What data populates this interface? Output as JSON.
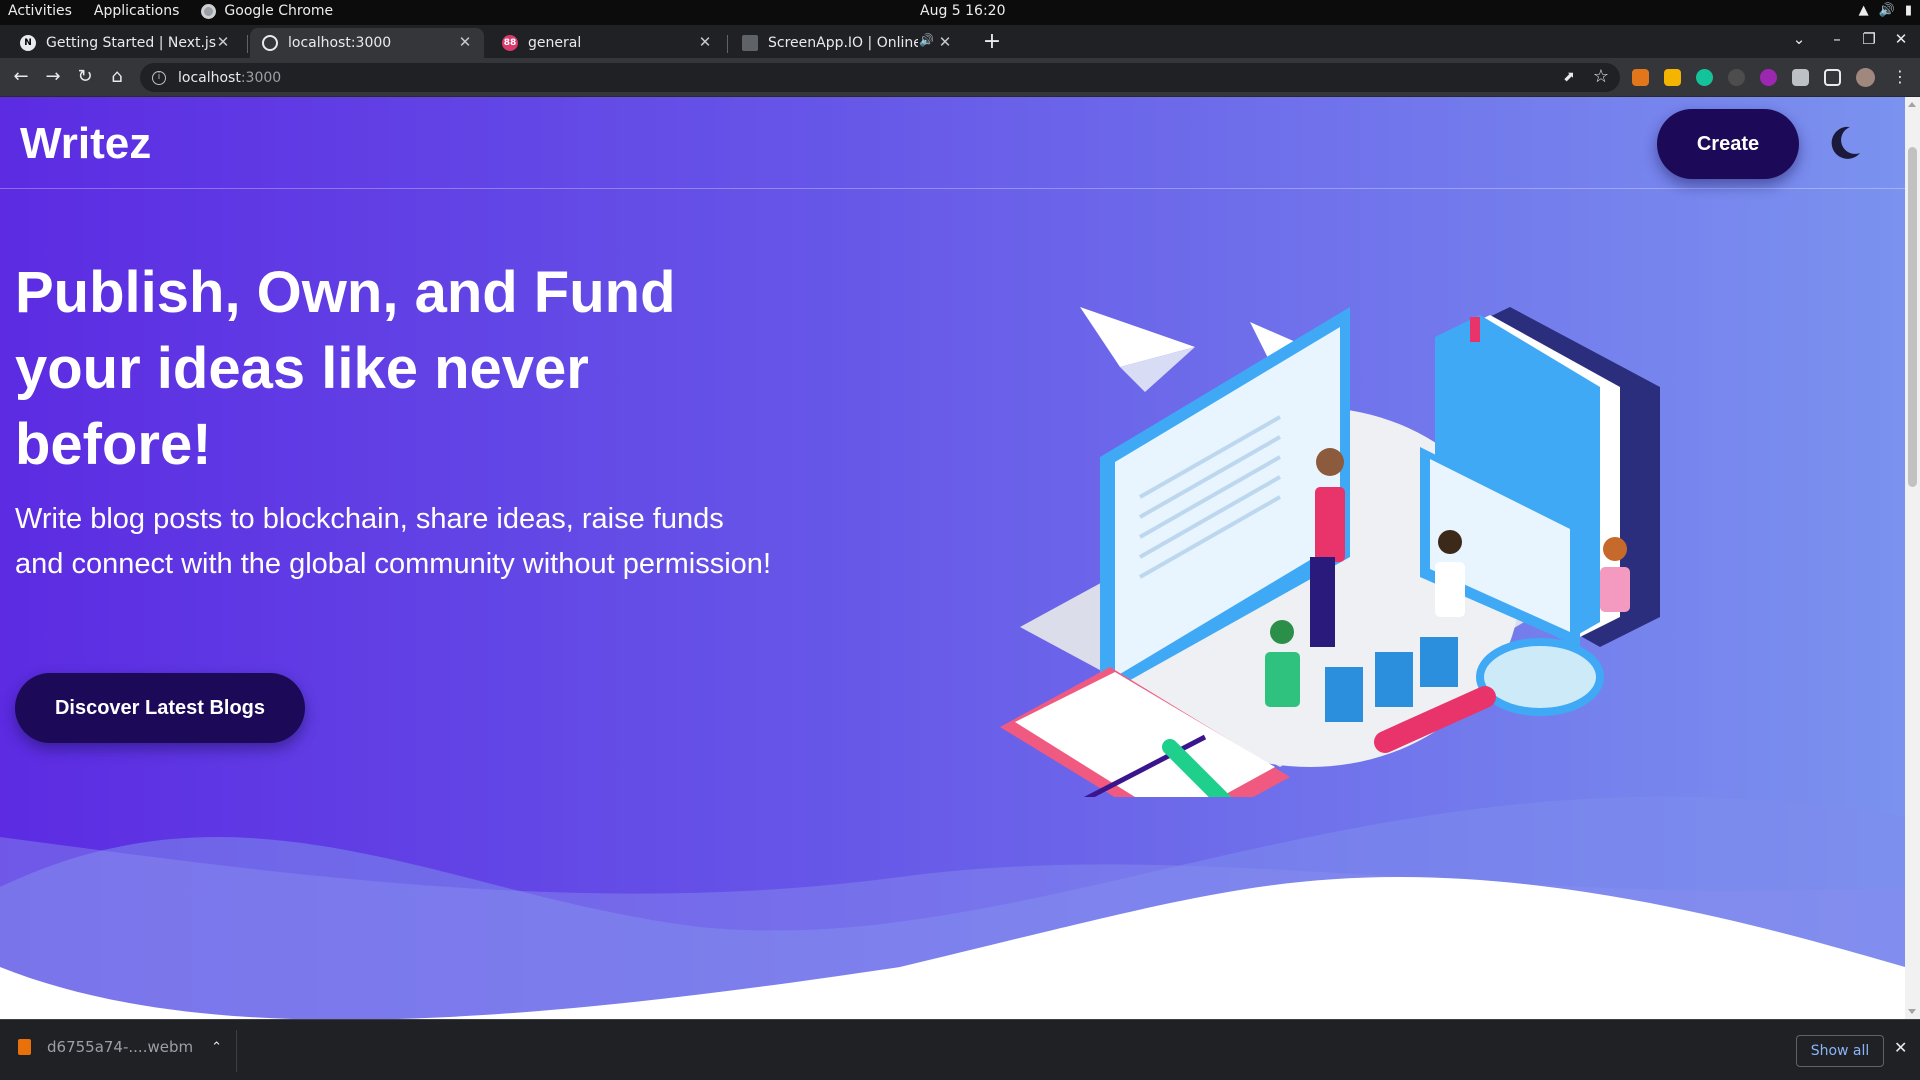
{
  "os_bar": {
    "activities": "Activities",
    "applications": "Applications",
    "app_name": "Google Chrome",
    "clock": "Aug 5  16:20"
  },
  "tabs": [
    {
      "title": "Getting Started | Next.js",
      "favicon": "nextjs-logo",
      "active": false
    },
    {
      "title": "localhost:3000",
      "favicon": "globe-icon",
      "active": true
    },
    {
      "title": "general",
      "favicon": "discord-logo",
      "active": false,
      "favicon_text": "88"
    },
    {
      "title": "ScreenApp.IO | Online",
      "favicon": "screenapp-logo",
      "active": false,
      "audio": true
    }
  ],
  "address_bar": {
    "host": "localhost",
    "port": ":3000"
  },
  "page": {
    "brand": "Writez",
    "create_label": "Create",
    "headline": "Publish, Own, and Fund your ideas like never before!",
    "subtext": "Write blog posts to blockchain, share ideas, raise funds and connect with the global community without permission!",
    "discover_label": "Discover Latest Blogs",
    "theme_toggle_icon": "moon-icon"
  },
  "downloads": {
    "file_name": "d6755a74-....webm",
    "show_all_label": "Show all"
  },
  "colors": {
    "hero_start": "#5c2be2",
    "hero_end": "#7b92ef",
    "button_bg": "#1c0a59",
    "chrome_dark": "#202124",
    "chrome_toolbar": "#35363a"
  }
}
